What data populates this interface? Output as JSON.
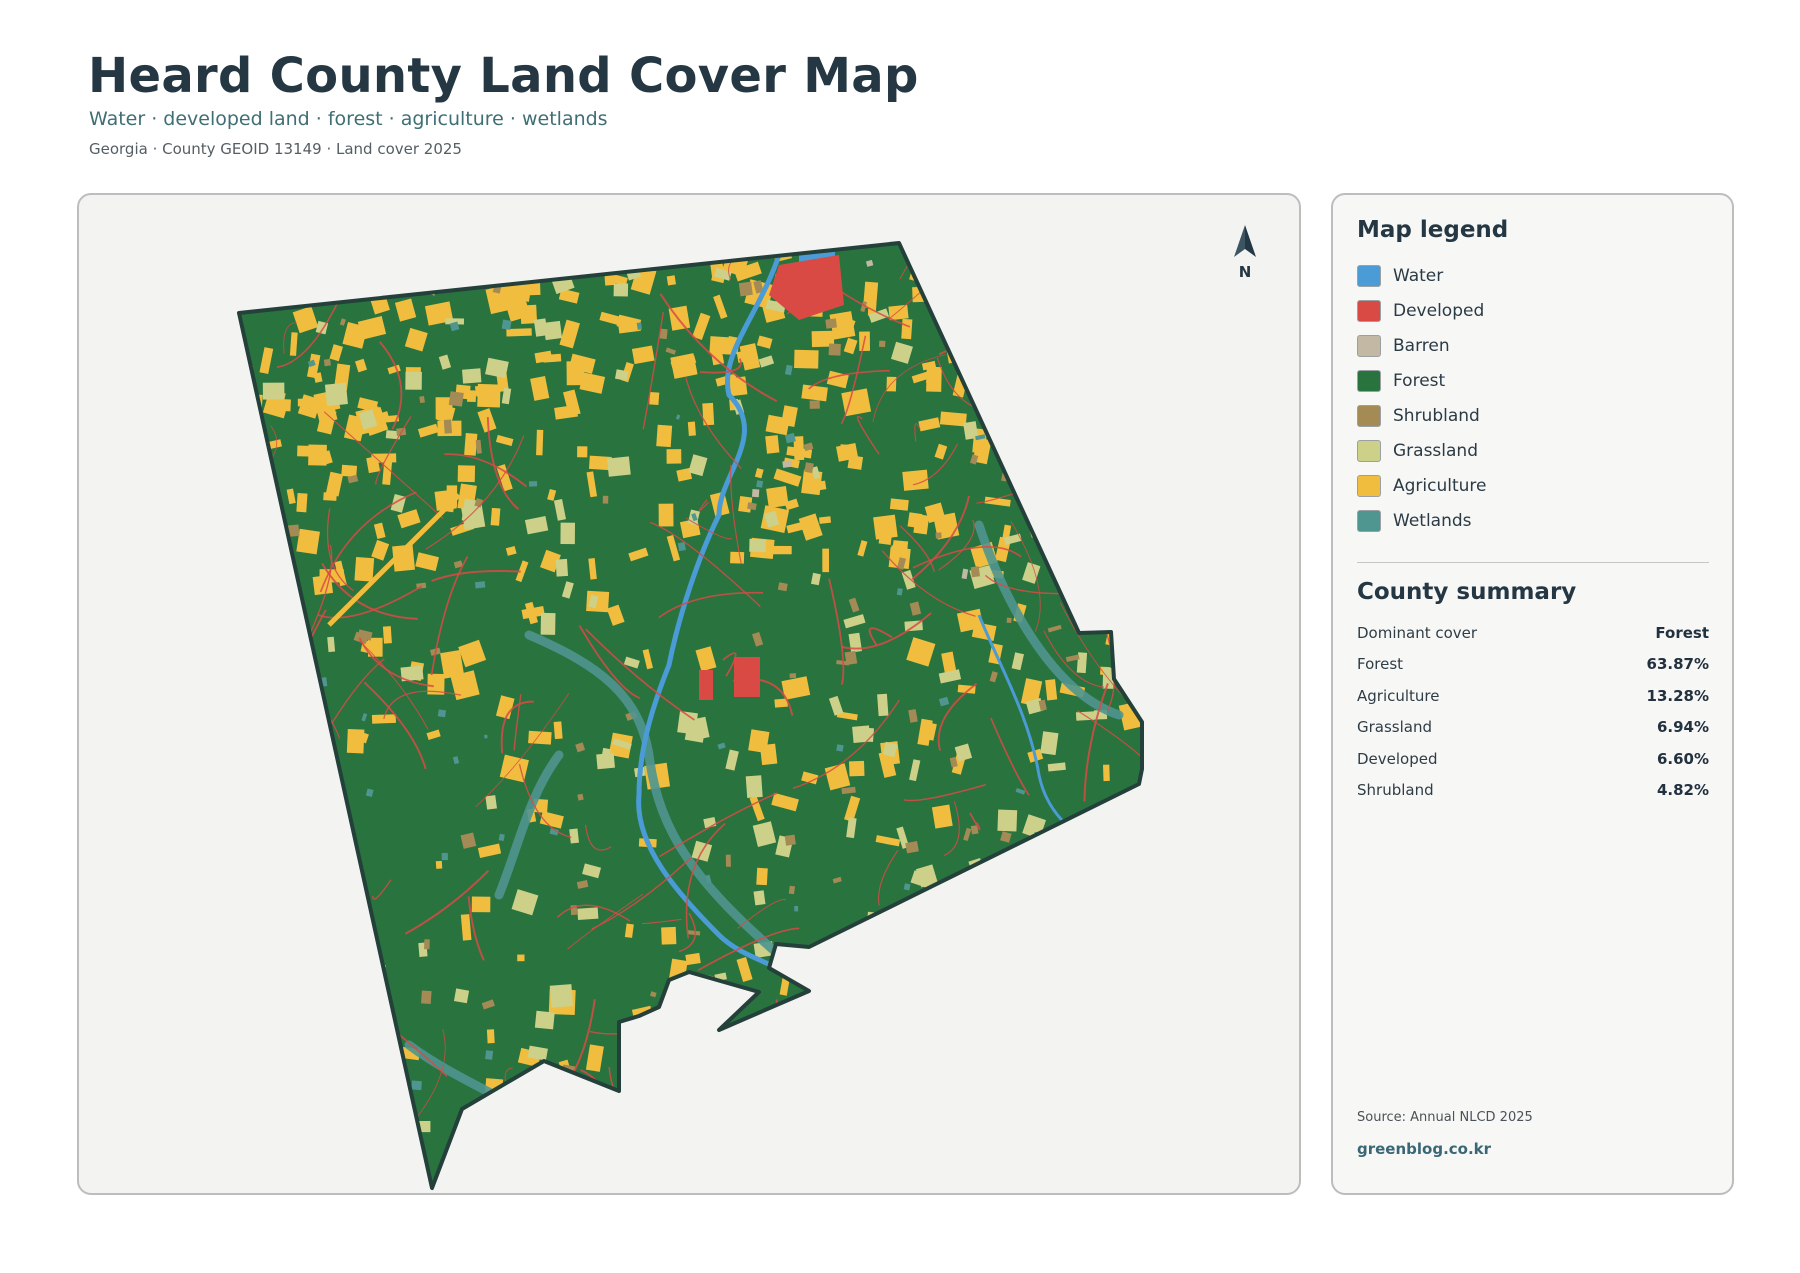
{
  "header": {
    "title": "Heard County Land Cover Map",
    "subtitle": "Water · developed land · forest · agriculture · wetlands",
    "meta": "Georgia · County GEOID 13149 · Land cover 2025"
  },
  "map": {
    "north_label": "N",
    "colors": {
      "water": "#4a9bd6",
      "developed": "#d94a45",
      "barren": "#c2b8a3",
      "forest": "#29733f",
      "shrubland": "#a48a55",
      "grassland": "#cdd088",
      "agriculture": "#f0bd3e",
      "wetlands": "#4f9590",
      "boundary": "#24403a"
    }
  },
  "legend": {
    "title": "Map legend",
    "items": [
      {
        "label": "Water",
        "color": "#4a9bd6"
      },
      {
        "label": "Developed",
        "color": "#d94a45"
      },
      {
        "label": "Barren",
        "color": "#c2b8a3"
      },
      {
        "label": "Forest",
        "color": "#29733f"
      },
      {
        "label": "Shrubland",
        "color": "#a48a55"
      },
      {
        "label": "Grassland",
        "color": "#cdd088"
      },
      {
        "label": "Agriculture",
        "color": "#f0bd3e"
      },
      {
        "label": "Wetlands",
        "color": "#4f9590"
      }
    ]
  },
  "summary": {
    "title": "County summary",
    "rows": [
      {
        "label": "Dominant cover",
        "value": "Forest"
      },
      {
        "label": "Forest",
        "value": "63.87%"
      },
      {
        "label": "Agriculture",
        "value": "13.28%"
      },
      {
        "label": "Grassland",
        "value": "6.94%"
      },
      {
        "label": "Developed",
        "value": "6.60%"
      },
      {
        "label": "Shrubland",
        "value": "4.82%"
      }
    ]
  },
  "footer": {
    "source": "Source: Annual NLCD 2025",
    "brand": "greenblog.co.kr"
  }
}
